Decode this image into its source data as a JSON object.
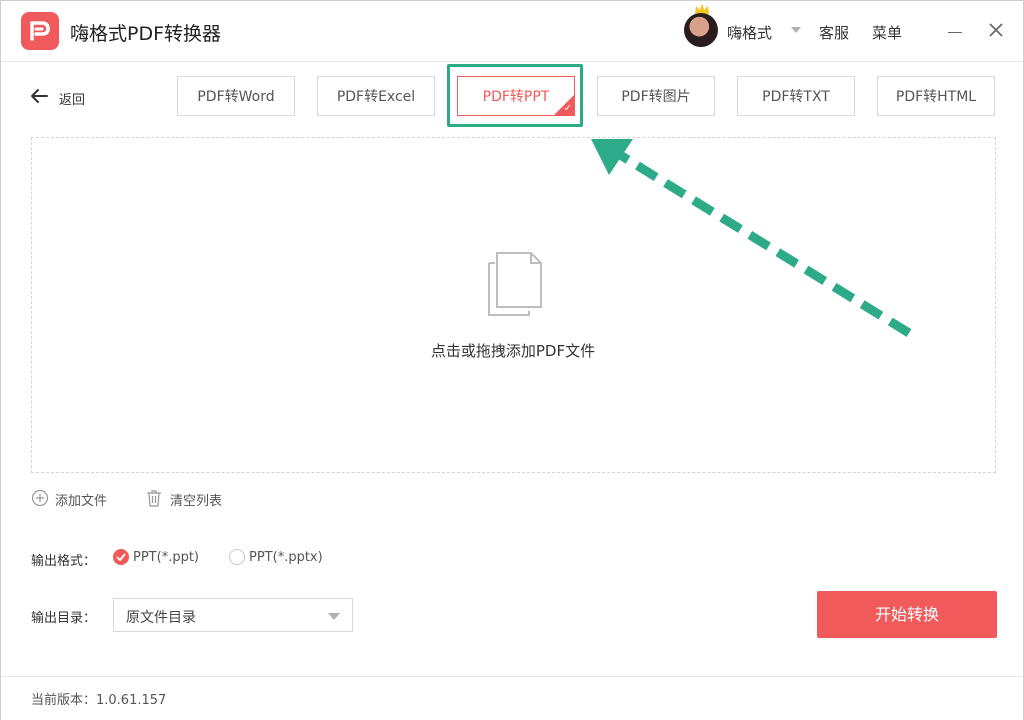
{
  "app": {
    "title": "嗨格式PDF转换器"
  },
  "header": {
    "user_name": "嗨格式",
    "customer_service": "客服",
    "menu": "菜单"
  },
  "nav": {
    "back_label": "返回"
  },
  "tabs": [
    {
      "label": "PDF转Word",
      "active": false
    },
    {
      "label": "PDF转Excel",
      "active": false
    },
    {
      "label": "PDF转PPT",
      "active": true
    },
    {
      "label": "PDF转图片",
      "active": false
    },
    {
      "label": "PDF转TXT",
      "active": false
    },
    {
      "label": "PDF转HTML",
      "active": false
    }
  ],
  "dropzone": {
    "hint": "点击或拖拽添加PDF文件"
  },
  "file_actions": {
    "add_file": "添加文件",
    "clear_list": "清空列表"
  },
  "output_format": {
    "label": "输出格式：",
    "options": [
      {
        "label": "PPT(*.ppt)",
        "selected": true
      },
      {
        "label": "PPT(*.pptx)",
        "selected": false
      }
    ]
  },
  "output_dir": {
    "label": "输出目录：",
    "value": "原文件目录"
  },
  "start_button": "开始转换",
  "footer": {
    "version": "当前版本：1.0.61.157"
  },
  "colors": {
    "accent": "#f05a5a",
    "highlight_annotation": "#2daa88"
  },
  "icons": [
    "app-logo-icon",
    "crown-icon",
    "chevron-down-icon",
    "minimize-icon",
    "close-icon",
    "back-arrow-icon",
    "check-corner-icon",
    "document-icon",
    "add-circle-icon",
    "trash-icon"
  ]
}
